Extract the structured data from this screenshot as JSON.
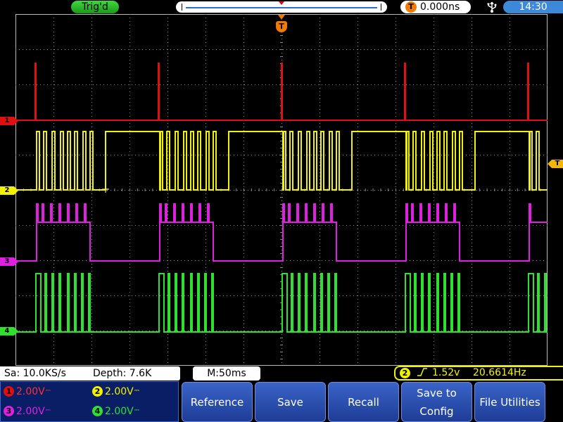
{
  "top_bar": {
    "trigger_state": "Trig'd",
    "trigger_position_icon": "T",
    "trigger_position": "0.000ns",
    "usb_icon": "usb-icon",
    "clock": "14:30"
  },
  "screen": {
    "channel_markers": [
      "1",
      "2",
      "3",
      "4"
    ],
    "trigger_level_marker": "T",
    "trigger_time_marker": "T",
    "colors": {
      "ch1": "#e01010",
      "ch2": "#f2f200",
      "ch3": "#e020e0",
      "ch4": "#30e030",
      "grid": "#8a8a8a"
    }
  },
  "status_bar": {
    "sample_rate": "Sa: 10.0KS/s",
    "depth": "Depth: 7.6K",
    "timebase": "M:50ms",
    "trigger_source": "2",
    "trigger_edge_icon": "rising-edge-icon",
    "trigger_level": "1.52v",
    "frequency": "20.6614Hz"
  },
  "channel_panel": {
    "ch1": {
      "num": "1",
      "scale": "2.00V"
    },
    "ch2": {
      "num": "2",
      "scale": "2.00V"
    },
    "ch3": {
      "num": "3",
      "scale": "2.00V"
    },
    "ch4": {
      "num": "4",
      "scale": "2.00V"
    }
  },
  "softkeys": {
    "reference": "Reference",
    "save": "Save",
    "recall": "Recall",
    "save_to_config_line1": "Save to",
    "save_to_config_line2": "Config",
    "file_utilities": "File Utilities"
  }
}
